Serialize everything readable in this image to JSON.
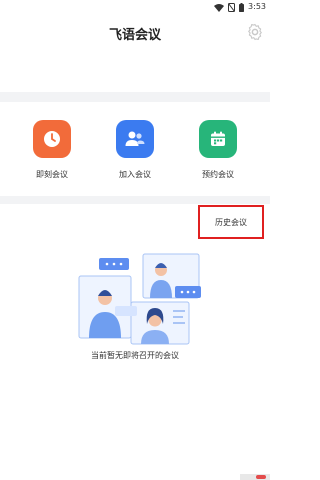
{
  "status_bar": {
    "time": "3:53"
  },
  "header": {
    "title": "飞语会议"
  },
  "actions": [
    {
      "label": "即刻会议",
      "icon": "clock-icon",
      "color": "#f26b3a"
    },
    {
      "label": "加入会议",
      "icon": "users-icon",
      "color": "#3b7bf0"
    },
    {
      "label": "预约会议",
      "icon": "calendar-icon",
      "color": "#27b57a"
    }
  ],
  "history": {
    "label": "历史会议"
  },
  "empty_state": {
    "text": "当前暂无即将召开的会议"
  },
  "colors": {
    "highlight_border": "#e02020",
    "separator": "#f2f3f5"
  }
}
